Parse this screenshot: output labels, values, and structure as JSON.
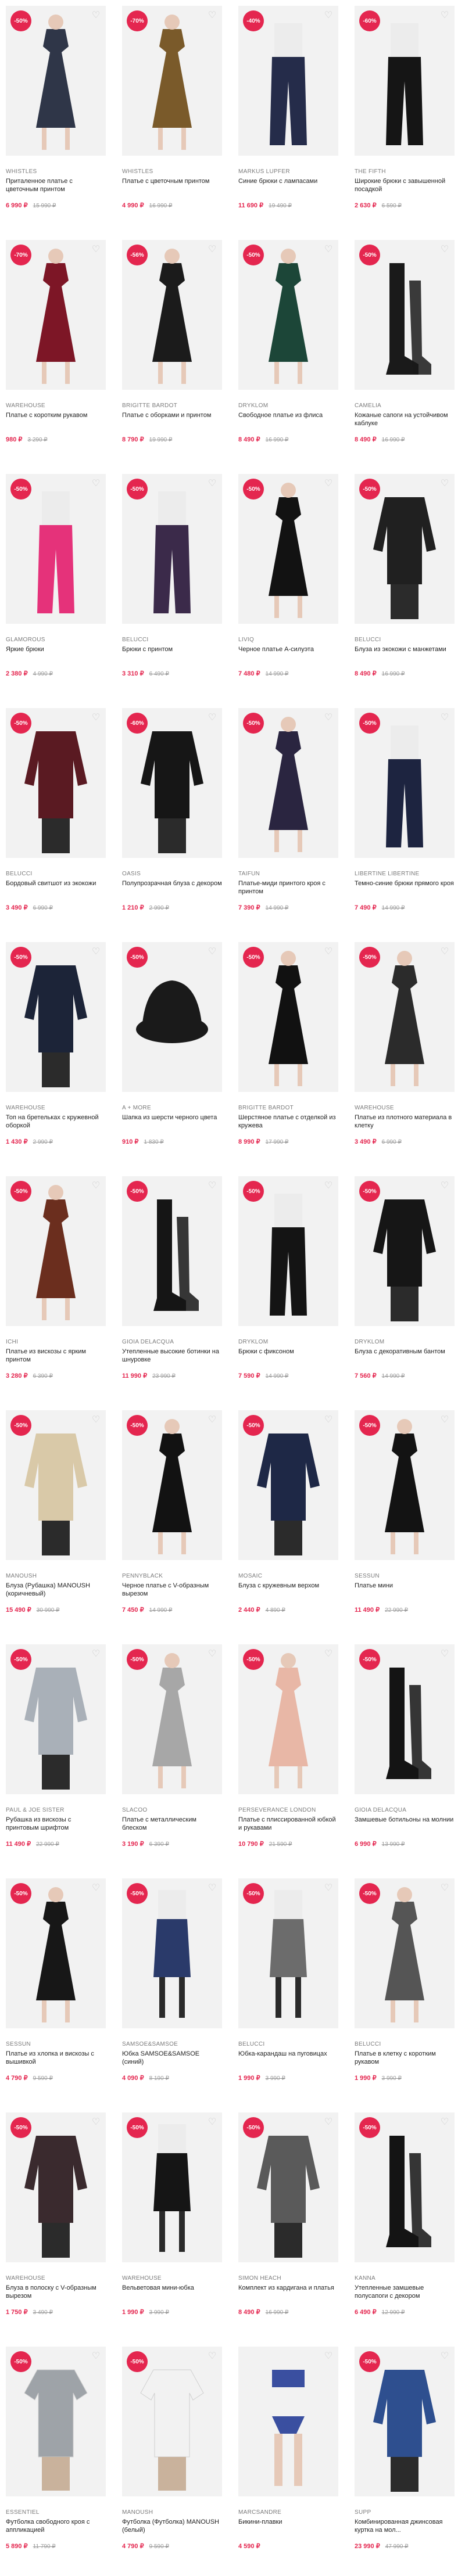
{
  "products": [
    {
      "brand": "WHISTLES",
      "title": "Приталенное платье с цветочным принтом",
      "price": "6 990 ₽",
      "old_price": "15 990 ₽",
      "discount": "-50%",
      "img": "dress",
      "color": "#2f3648"
    },
    {
      "brand": "WHISTLES",
      "title": "Платье с цветочным принтом",
      "price": "4 990 ₽",
      "old_price": "16 990 ₽",
      "discount": "-70%",
      "img": "dress",
      "color": "#7a5a2a"
    },
    {
      "brand": "MARKUS LUPFER",
      "title": "Синие брюки с лампасами",
      "price": "11 690 ₽",
      "old_price": "19 490 ₽",
      "discount": "-40%",
      "img": "pants",
      "color": "#252c4a"
    },
    {
      "brand": "THE FIFTH",
      "title": "Широкие брюки с завышенной посадкой",
      "price": "2 630 ₽",
      "old_price": "6 590 ₽",
      "discount": "-60%",
      "img": "pants",
      "color": "#151515"
    },
    {
      "brand": "WAREHOUSE",
      "title": "Платье с коротким рукавом",
      "price": "980 ₽",
      "old_price": "3 290 ₽",
      "discount": "-70%",
      "img": "dress",
      "color": "#7d1626"
    },
    {
      "brand": "BRIGITTE BARDOT",
      "title": "Платье с оборками и принтом",
      "price": "8 790 ₽",
      "old_price": "19 990 ₽",
      "discount": "-56%",
      "img": "dress",
      "color": "#1b1b1b"
    },
    {
      "brand": "Dryklom",
      "title": "Свободное платье из флиса",
      "price": "8 490 ₽",
      "old_price": "16 990 ₽",
      "discount": "-50%",
      "img": "dress",
      "color": "#1c4638"
    },
    {
      "brand": "Camelia",
      "title": "Кожаные сапоги на устойчивом каблуке",
      "price": "8 490 ₽",
      "old_price": "16 990 ₽",
      "discount": "-50%",
      "img": "boots",
      "color": "#1a1a1a"
    },
    {
      "brand": "GLAMOROUS",
      "title": "Яркие брюки",
      "price": "2 380 ₽",
      "old_price": "4 990 ₽",
      "discount": "-50%",
      "img": "pants",
      "color": "#e5327a"
    },
    {
      "brand": "BELUCCI",
      "title": "Брюки с принтом",
      "price": "3 310 ₽",
      "old_price": "6 490 ₽",
      "discount": "-50%",
      "img": "pants",
      "color": "#3b2a4a"
    },
    {
      "brand": "LIVIQ",
      "title": "Черное платье А-силуэта",
      "price": "7 480 ₽",
      "old_price": "14 990 ₽",
      "discount": "-50%",
      "img": "dress",
      "color": "#121212"
    },
    {
      "brand": "BELUCCI",
      "title": "Блуза из экокожи с манжетами",
      "price": "8 490 ₽",
      "old_price": "16 990 ₽",
      "discount": "-50%",
      "img": "top",
      "color": "#202020"
    },
    {
      "brand": "BELUCCI",
      "title": "Бордовый свитшот из экокожи",
      "price": "3 490 ₽",
      "old_price": "6 990 ₽",
      "discount": "-50%",
      "img": "top",
      "color": "#5a1a22"
    },
    {
      "brand": "Oasis",
      "title": "Полупрозрачная блуза с декором",
      "price": "1 210 ₽",
      "old_price": "2 990 ₽",
      "discount": "-60%",
      "img": "top",
      "color": "#161616"
    },
    {
      "brand": "Taifun",
      "title": "Платье-миди принтого кроя с принтом",
      "price": "7 390 ₽",
      "old_price": "14 990 ₽",
      "discount": "-50%",
      "img": "dress",
      "color": "#2a2540"
    },
    {
      "brand": "LIBERTINE LIBERTINE",
      "title": "Темно-синие брюки прямого кроя",
      "price": "7 490 ₽",
      "old_price": "14 990 ₽",
      "discount": "-50%",
      "img": "pants",
      "color": "#1d2440"
    },
    {
      "brand": "WAREHOUSE",
      "title": "Топ на бретельках с кружевной оборкой",
      "price": "1 430 ₽",
      "old_price": "2 990 ₽",
      "discount": "-50%",
      "img": "top",
      "color": "#1c2438"
    },
    {
      "brand": "A + MORE",
      "title": "Шапка из шерсти черного цвета",
      "price": "910 ₽",
      "old_price": "1 830 ₽",
      "discount": "-50%",
      "img": "hat",
      "color": "#1a1a1a"
    },
    {
      "brand": "BRIGITTE BARDOT",
      "title": "Шерстяное платье с отделкой из кружева",
      "price": "8 990 ₽",
      "old_price": "17 990 ₽",
      "discount": "-50%",
      "img": "dress",
      "color": "#111111"
    },
    {
      "brand": "WAREHOUSE",
      "title": "Платье из плотного материала в клетку",
      "price": "3 490 ₽",
      "old_price": "6 990 ₽",
      "discount": "-50%",
      "img": "dress",
      "color": "#2b2b2b"
    },
    {
      "brand": "ICHI",
      "title": "Платье из вискозы с ярким принтом",
      "price": "3 280 ₽",
      "old_price": "6 390 ₽",
      "discount": "-50%",
      "img": "dress",
      "color": "#6b2e1e"
    },
    {
      "brand": "Gioia DelAcqua",
      "title": "Утепленные высокие ботинки на шнуровке",
      "price": "11 990 ₽",
      "old_price": "23 990 ₽",
      "discount": "-50%",
      "img": "boots",
      "color": "#151515"
    },
    {
      "brand": "Dryklom",
      "title": "Брюки с фиксоном",
      "price": "7 590 ₽",
      "old_price": "14 990 ₽",
      "discount": "-50%",
      "img": "pants",
      "color": "#141414"
    },
    {
      "brand": "Dryklom",
      "title": "Блуза с декоративным бантом",
      "price": "7 560 ₽",
      "old_price": "14 990 ₽",
      "discount": "-50%",
      "img": "top",
      "color": "#161616"
    },
    {
      "brand": "MANOUSH",
      "title": "Блуза (Рубашка) MANOUSH (коричневый)",
      "price": "15 490 ₽",
      "old_price": "30 990 ₽",
      "discount": "-50%",
      "img": "top",
      "color": "#d9c9a8"
    },
    {
      "brand": "PENNYBLACK",
      "title": "Черное платье с V-образным вырезом",
      "price": "7 450 ₽",
      "old_price": "14 990 ₽",
      "discount": "-50%",
      "img": "dress",
      "color": "#121212"
    },
    {
      "brand": "Mosaic",
      "title": "Блуза с кружевным верхом",
      "price": "2 440 ₽",
      "old_price": "4 890 ₽",
      "discount": "-50%",
      "img": "top",
      "color": "#1e2846"
    },
    {
      "brand": "SESSUN",
      "title": "Платье мини",
      "price": "11 490 ₽",
      "old_price": "22 990 ₽",
      "discount": "-50%",
      "img": "dress",
      "color": "#131313"
    },
    {
      "brand": "PAUL & JOE SISTER",
      "title": "Рубашка из вискозы с принтовым шрифтом",
      "price": "11 490 ₽",
      "old_price": "22 990 ₽",
      "discount": "-50%",
      "img": "top",
      "color": "#a9b0b8"
    },
    {
      "brand": "SLACOO",
      "title": "Платье с металлическим блеском",
      "price": "3 190 ₽",
      "old_price": "6 390 ₽",
      "discount": "-50%",
      "img": "dress",
      "color": "#a7a7a7"
    },
    {
      "brand": "PERSEVERANCE LONDON",
      "title": "Платье с плиссированной юбкой и рукавами",
      "price": "10 790 ₽",
      "old_price": "21 590 ₽",
      "discount": "-50%",
      "img": "dress",
      "color": "#e8b7a6"
    },
    {
      "brand": "Gioia DelAcqua",
      "title": "Замшевые ботильоны на молнии",
      "price": "6 990 ₽",
      "old_price": "13 990 ₽",
      "discount": "-50%",
      "img": "boots",
      "color": "#141414"
    },
    {
      "brand": "SESSUN",
      "title": "Платье из хлопка и вискозы с вышивкой",
      "price": "4 790 ₽",
      "old_price": "9 590 ₽",
      "discount": "-50%",
      "img": "dress",
      "color": "#171717"
    },
    {
      "brand": "SAMSOE&SAMSOE",
      "title": "Юбка SAMSOE&SAMSOE (синий)",
      "price": "4 090 ₽",
      "old_price": "8 190 ₽",
      "discount": "-50%",
      "img": "skirt",
      "color": "#2a3a6a"
    },
    {
      "brand": "BELUCCI",
      "title": "Юбка-карандаш на пуговицах",
      "price": "1 990 ₽",
      "old_price": "3 990 ₽",
      "discount": "-50%",
      "img": "skirt",
      "color": "#6c6c6c"
    },
    {
      "brand": "BELUCCI",
      "title": "Платье в клетку с коротким рукавом",
      "price": "1 990 ₽",
      "old_price": "3 990 ₽",
      "discount": "-50%",
      "img": "dress",
      "color": "#555555"
    },
    {
      "brand": "WAREHOUSE",
      "title": "Блуза в полоску с V-образным вырезом",
      "price": "1 750 ₽",
      "old_price": "3 490 ₽",
      "discount": "-50%",
      "img": "top",
      "color": "#3a2a2e"
    },
    {
      "brand": "WAREHOUSE",
      "title": "Вельветовая мини-юбка",
      "price": "1 990 ₽",
      "old_price": "3 990 ₽",
      "discount": "-50%",
      "img": "skirt",
      "color": "#151515"
    },
    {
      "brand": "Simon Heach",
      "title": "Комплект из кардигана и платья",
      "price": "8 490 ₽",
      "old_price": "16 990 ₽",
      "discount": "-50%",
      "img": "top",
      "color": "#5a5a5a"
    },
    {
      "brand": "Kanna",
      "title": "Утепленные замшевые полусапоги с декором",
      "price": "6 490 ₽",
      "old_price": "12 990 ₽",
      "discount": "-50%",
      "img": "boots",
      "color": "#141414"
    },
    {
      "brand": "ESSENTIEL",
      "title": "Футболка свободного кроя с аппликацией",
      "price": "5 890 ₽",
      "old_price": "11 790 ₽",
      "discount": "-50%",
      "img": "tee",
      "color": "#9ea3a8"
    },
    {
      "brand": "MANOUSH",
      "title": "Футболка (Футболка) MANOUSH (белый)",
      "price": "4 790 ₽",
      "old_price": "9 590 ₽",
      "discount": "-50%",
      "img": "tee",
      "color": "#f2f2f2"
    },
    {
      "brand": "MARCSANDRE",
      "title": "Бикини-плавки",
      "price": "4 590 ₽",
      "old_price": "",
      "discount": "",
      "img": "swim",
      "color": "#3a4fa0"
    },
    {
      "brand": "SUPP",
      "title": "Комбинированная джинсовая куртка на мол...",
      "price": "23 990 ₽",
      "old_price": "47 990 ₽",
      "discount": "-50%",
      "img": "top",
      "color": "#2e4f8f"
    }
  ]
}
